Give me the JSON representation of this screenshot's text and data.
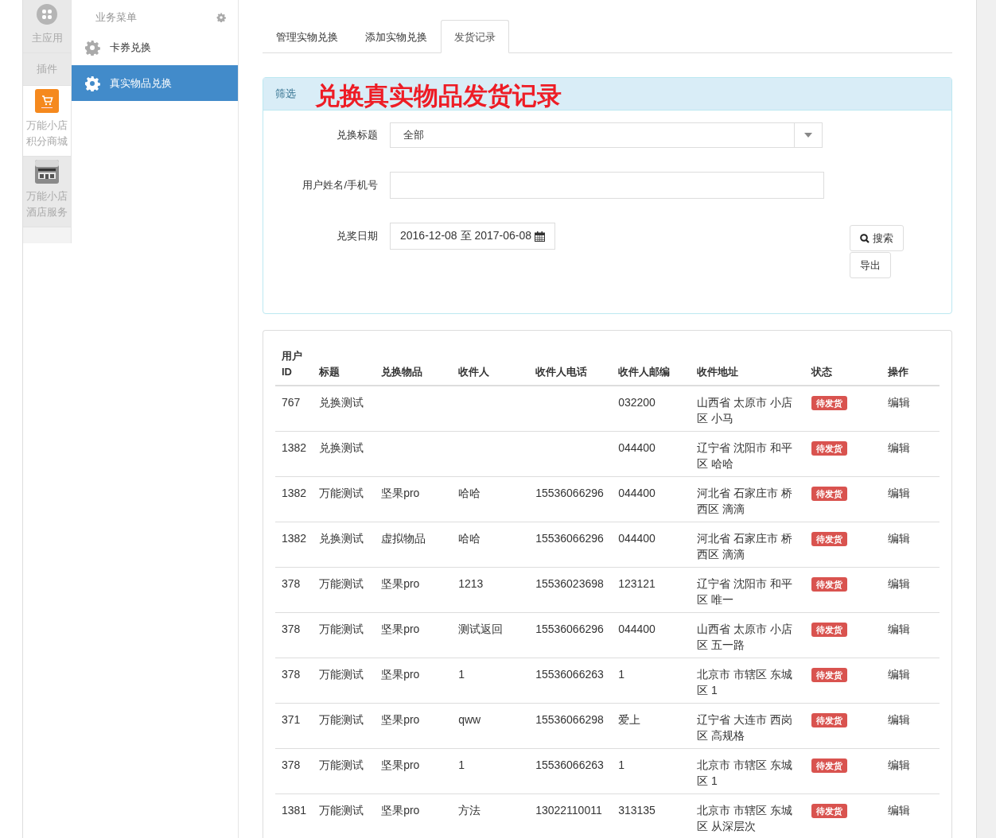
{
  "app_nav": [
    {
      "label": "主应用",
      "selected": false
    },
    {
      "label": "插件",
      "selected": false
    },
    {
      "label": "万能小店积分商城",
      "selected": true
    },
    {
      "label": "万能小店酒店服务",
      "selected": false
    }
  ],
  "menu": {
    "title": "业务菜单",
    "items": [
      {
        "label": "卡券兑换",
        "selected": false
      },
      {
        "label": "真实物品兑换",
        "selected": true
      }
    ]
  },
  "tabs": [
    {
      "label": "管理实物兑换",
      "selected": false
    },
    {
      "label": "添加实物兑换",
      "selected": false
    },
    {
      "label": "发货记录",
      "selected": true
    }
  ],
  "filter": {
    "heading": "筛选",
    "title": "兑换真实物品发货记录",
    "fields": [
      {
        "kind": "select",
        "label": "兑换标题",
        "value": "全部"
      },
      {
        "kind": "text",
        "label": "用户姓名/手机号"
      },
      {
        "kind": "date",
        "label": "兑奖日期",
        "value": "2016-12-08 至 2017-06-08"
      }
    ],
    "buttons": [
      {
        "label": "搜索",
        "kind": "search"
      },
      {
        "label": "导出",
        "kind": "plain"
      }
    ]
  },
  "table": {
    "columns": [
      "用户ID",
      "标题",
      "兑换物品",
      "收件人",
      "收件人电话",
      "收件人邮编",
      "收件地址",
      "状态",
      "操作"
    ],
    "rows": [
      {
        "cells": [
          "767",
          "兑换测试",
          null,
          null,
          null,
          "032200",
          "山西省 太原市 小店区 小马"
        ],
        "status": "待发货",
        "action": "编辑"
      },
      {
        "cells": [
          "1382",
          "兑换测试",
          null,
          null,
          null,
          "044400",
          "辽宁省 沈阳市 和平区 哈哈"
        ],
        "status": "待发货",
        "action": "编辑"
      },
      {
        "cells": [
          "1382",
          "万能测试",
          "坚果pro",
          "哈哈",
          "15536066296",
          "044400",
          "河北省 石家庄市 桥西区 滴滴"
        ],
        "status": "待发货",
        "action": "编辑"
      },
      {
        "cells": [
          "1382",
          "兑换测试",
          "虚拟物品",
          "哈哈",
          "15536066296",
          "044400",
          "河北省 石家庄市 桥西区 滴滴"
        ],
        "status": "待发货",
        "action": "编辑"
      },
      {
        "cells": [
          "378",
          "万能测试",
          "坚果pro",
          "1213",
          "15536023698",
          "123121",
          "辽宁省 沈阳市 和平区 唯一"
        ],
        "status": "待发货",
        "action": "编辑"
      },
      {
        "cells": [
          "378",
          "万能测试",
          "坚果pro",
          "测试返回",
          "15536066296",
          "044400",
          "山西省 太原市 小店区 五一路"
        ],
        "status": "待发货",
        "action": "编辑"
      },
      {
        "cells": [
          "378",
          "万能测试",
          "坚果pro",
          "1",
          "15536066263",
          "1",
          "北京市 市辖区 东城区 1"
        ],
        "status": "待发货",
        "action": "编辑"
      },
      {
        "cells": [
          "371",
          "万能测试",
          "坚果pro",
          "qww",
          "15536066298",
          "爱上",
          "辽宁省 大连市 西岗区 高规格"
        ],
        "status": "待发货",
        "action": "编辑"
      },
      {
        "cells": [
          "378",
          "万能测试",
          "坚果pro",
          "1",
          "15536066263",
          "1",
          "北京市 市辖区 东城区 1"
        ],
        "status": "待发货",
        "action": "编辑"
      },
      {
        "cells": [
          "1381",
          "万能测试",
          "坚果pro",
          "方法",
          "13022110011",
          "313135",
          "北京市 市辖区 东城区 从深层次"
        ],
        "status": "待发货",
        "action": "编辑"
      }
    ]
  }
}
